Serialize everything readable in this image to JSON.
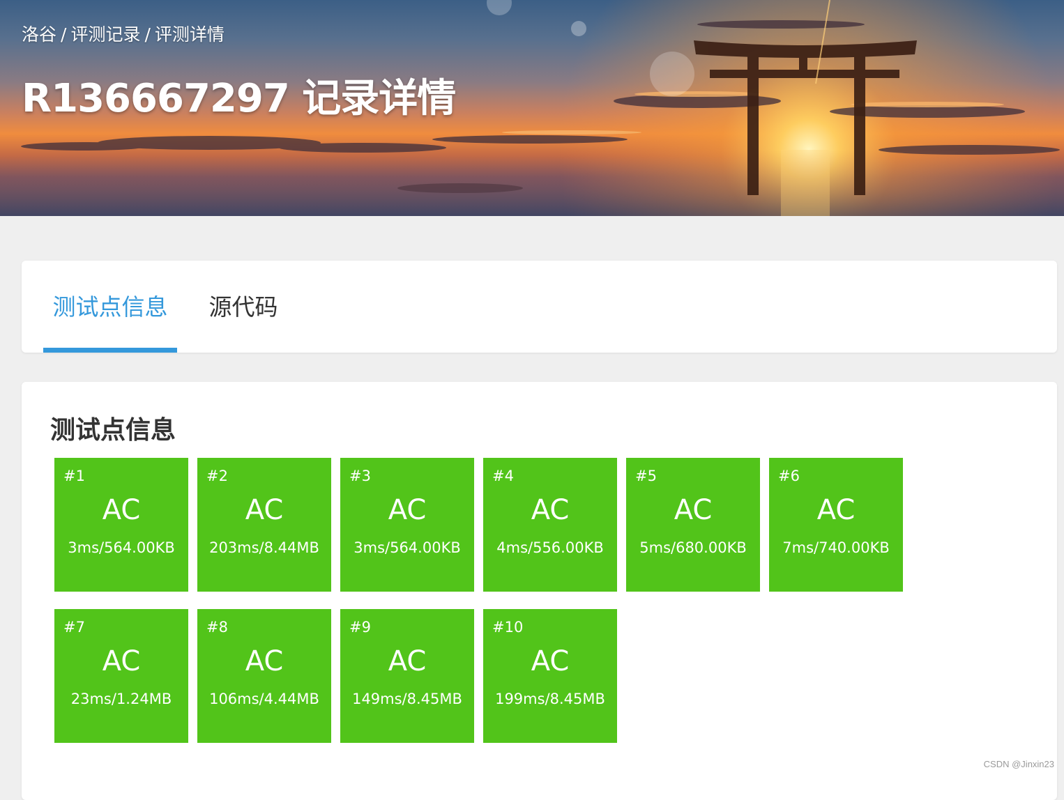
{
  "header": {
    "breadcrumb": [
      {
        "label": "洛谷"
      },
      {
        "label": "评测记录"
      },
      {
        "label": "评测详情"
      }
    ],
    "breadcrumb_separator": "/",
    "title": "R136667297 记录详情"
  },
  "tabs": [
    {
      "label": "测试点信息",
      "active": true
    },
    {
      "label": "源代码",
      "active": false
    }
  ],
  "testcases_section": {
    "title": "测试点信息",
    "items": [
      {
        "id": "#1",
        "status": "AC",
        "info": "3ms/564.00KB"
      },
      {
        "id": "#2",
        "status": "AC",
        "info": "203ms/8.44MB"
      },
      {
        "id": "#3",
        "status": "AC",
        "info": "3ms/564.00KB"
      },
      {
        "id": "#4",
        "status": "AC",
        "info": "4ms/556.00KB"
      },
      {
        "id": "#5",
        "status": "AC",
        "info": "5ms/680.00KB"
      },
      {
        "id": "#6",
        "status": "AC",
        "info": "7ms/740.00KB"
      },
      {
        "id": "#7",
        "status": "AC",
        "info": "23ms/1.24MB"
      },
      {
        "id": "#8",
        "status": "AC",
        "info": "106ms/4.44MB"
      },
      {
        "id": "#9",
        "status": "AC",
        "info": "149ms/8.45MB"
      },
      {
        "id": "#10",
        "status": "AC",
        "info": "199ms/8.45MB"
      }
    ]
  },
  "colors": {
    "accepted": "#52c41a",
    "active_tab": "#3498db",
    "page_background": "#efefef"
  },
  "watermark": "CSDN @Jinxin23"
}
